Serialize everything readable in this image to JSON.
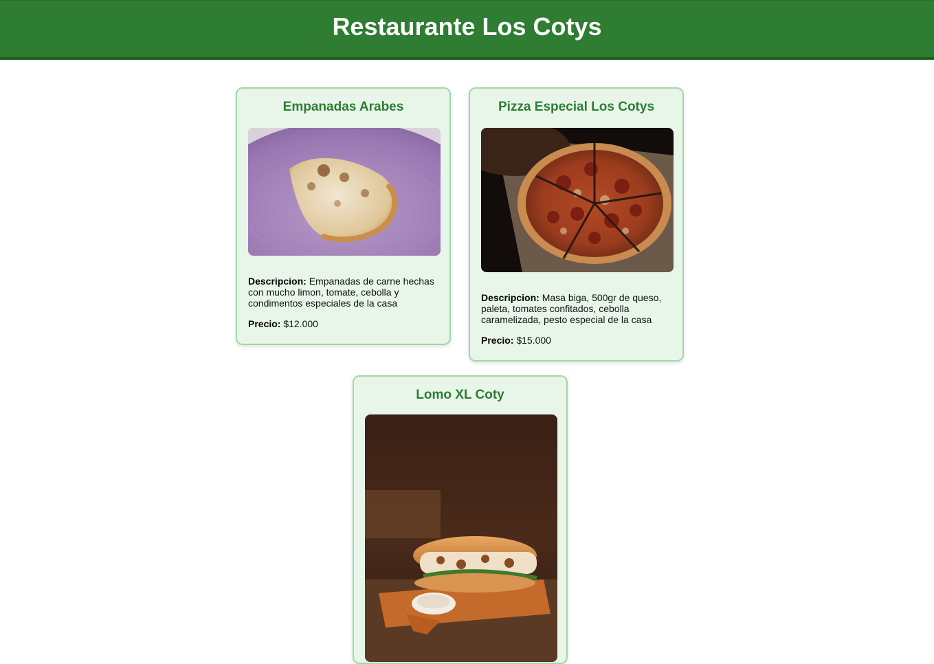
{
  "header": {
    "title": "Restaurante Los Cotys"
  },
  "menu": [
    {
      "name": "Empanadas Arabes",
      "image": "empanada-photo",
      "description_label": "Descripcion:",
      "description": "Empanadas de carne hechas con mucho limon, tomate, cebolla y condimentos especiales de la casa",
      "price_label": "Precio:",
      "price": "$12.000"
    },
    {
      "name": "Pizza Especial Los Cotys",
      "image": "pizza-photo",
      "description_label": "Descripcion:",
      "description": "Masa biga, 500gr de queso, paleta, tomates confitados, cebolla caramelizada, pesto especial de la casa",
      "price_label": "Precio:",
      "price": "$15.000"
    },
    {
      "name": "Lomo XL Coty",
      "image": "sandwich-photo"
    }
  ],
  "colors": {
    "header_bg": "#2e7d32",
    "card_bg": "#e8f5e9",
    "card_border": "#a5d6a7",
    "title_green": "#2e7d32"
  }
}
